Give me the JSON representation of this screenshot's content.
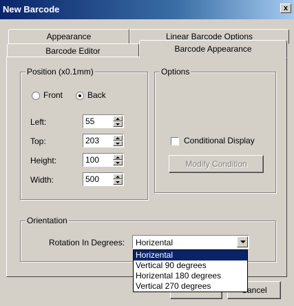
{
  "window": {
    "title": "New Barcode",
    "close_label": "x"
  },
  "tabs": {
    "back_row": [
      {
        "label": "Appearance"
      },
      {
        "label": "Linear Barcode Options"
      }
    ],
    "front_row": [
      {
        "label": "Barcode Editor"
      },
      {
        "label": "Barcode Appearance",
        "selected": true
      }
    ]
  },
  "position": {
    "legend": "Position (x0.1mm)",
    "front_label": "Front",
    "back_label": "Back",
    "selected": "Back",
    "left_label": "Left:",
    "left_value": "55",
    "top_label": "Top:",
    "top_value": "203",
    "height_label": "Height:",
    "height_value": "100",
    "width_label": "Width:",
    "width_value": "500"
  },
  "options": {
    "legend": "Options",
    "conditional_display_label": "Conditional Display",
    "conditional_display_checked": false,
    "modify_condition_label": "Modify Condition"
  },
  "orientation": {
    "legend": "Orientation",
    "rotation_label": "Rotation In Degrees:",
    "rotation_value": "Horizental",
    "rotation_options": [
      "Horizental",
      "Vertical 90 degrees",
      "Horizental 180 degrees",
      "Vertical 270 degrees"
    ]
  },
  "footer": {
    "cancel_label": "Cancel"
  },
  "colors": {
    "title_bar": "#0a246a",
    "face": "#d4d0c8",
    "selection": "#0a246a"
  }
}
